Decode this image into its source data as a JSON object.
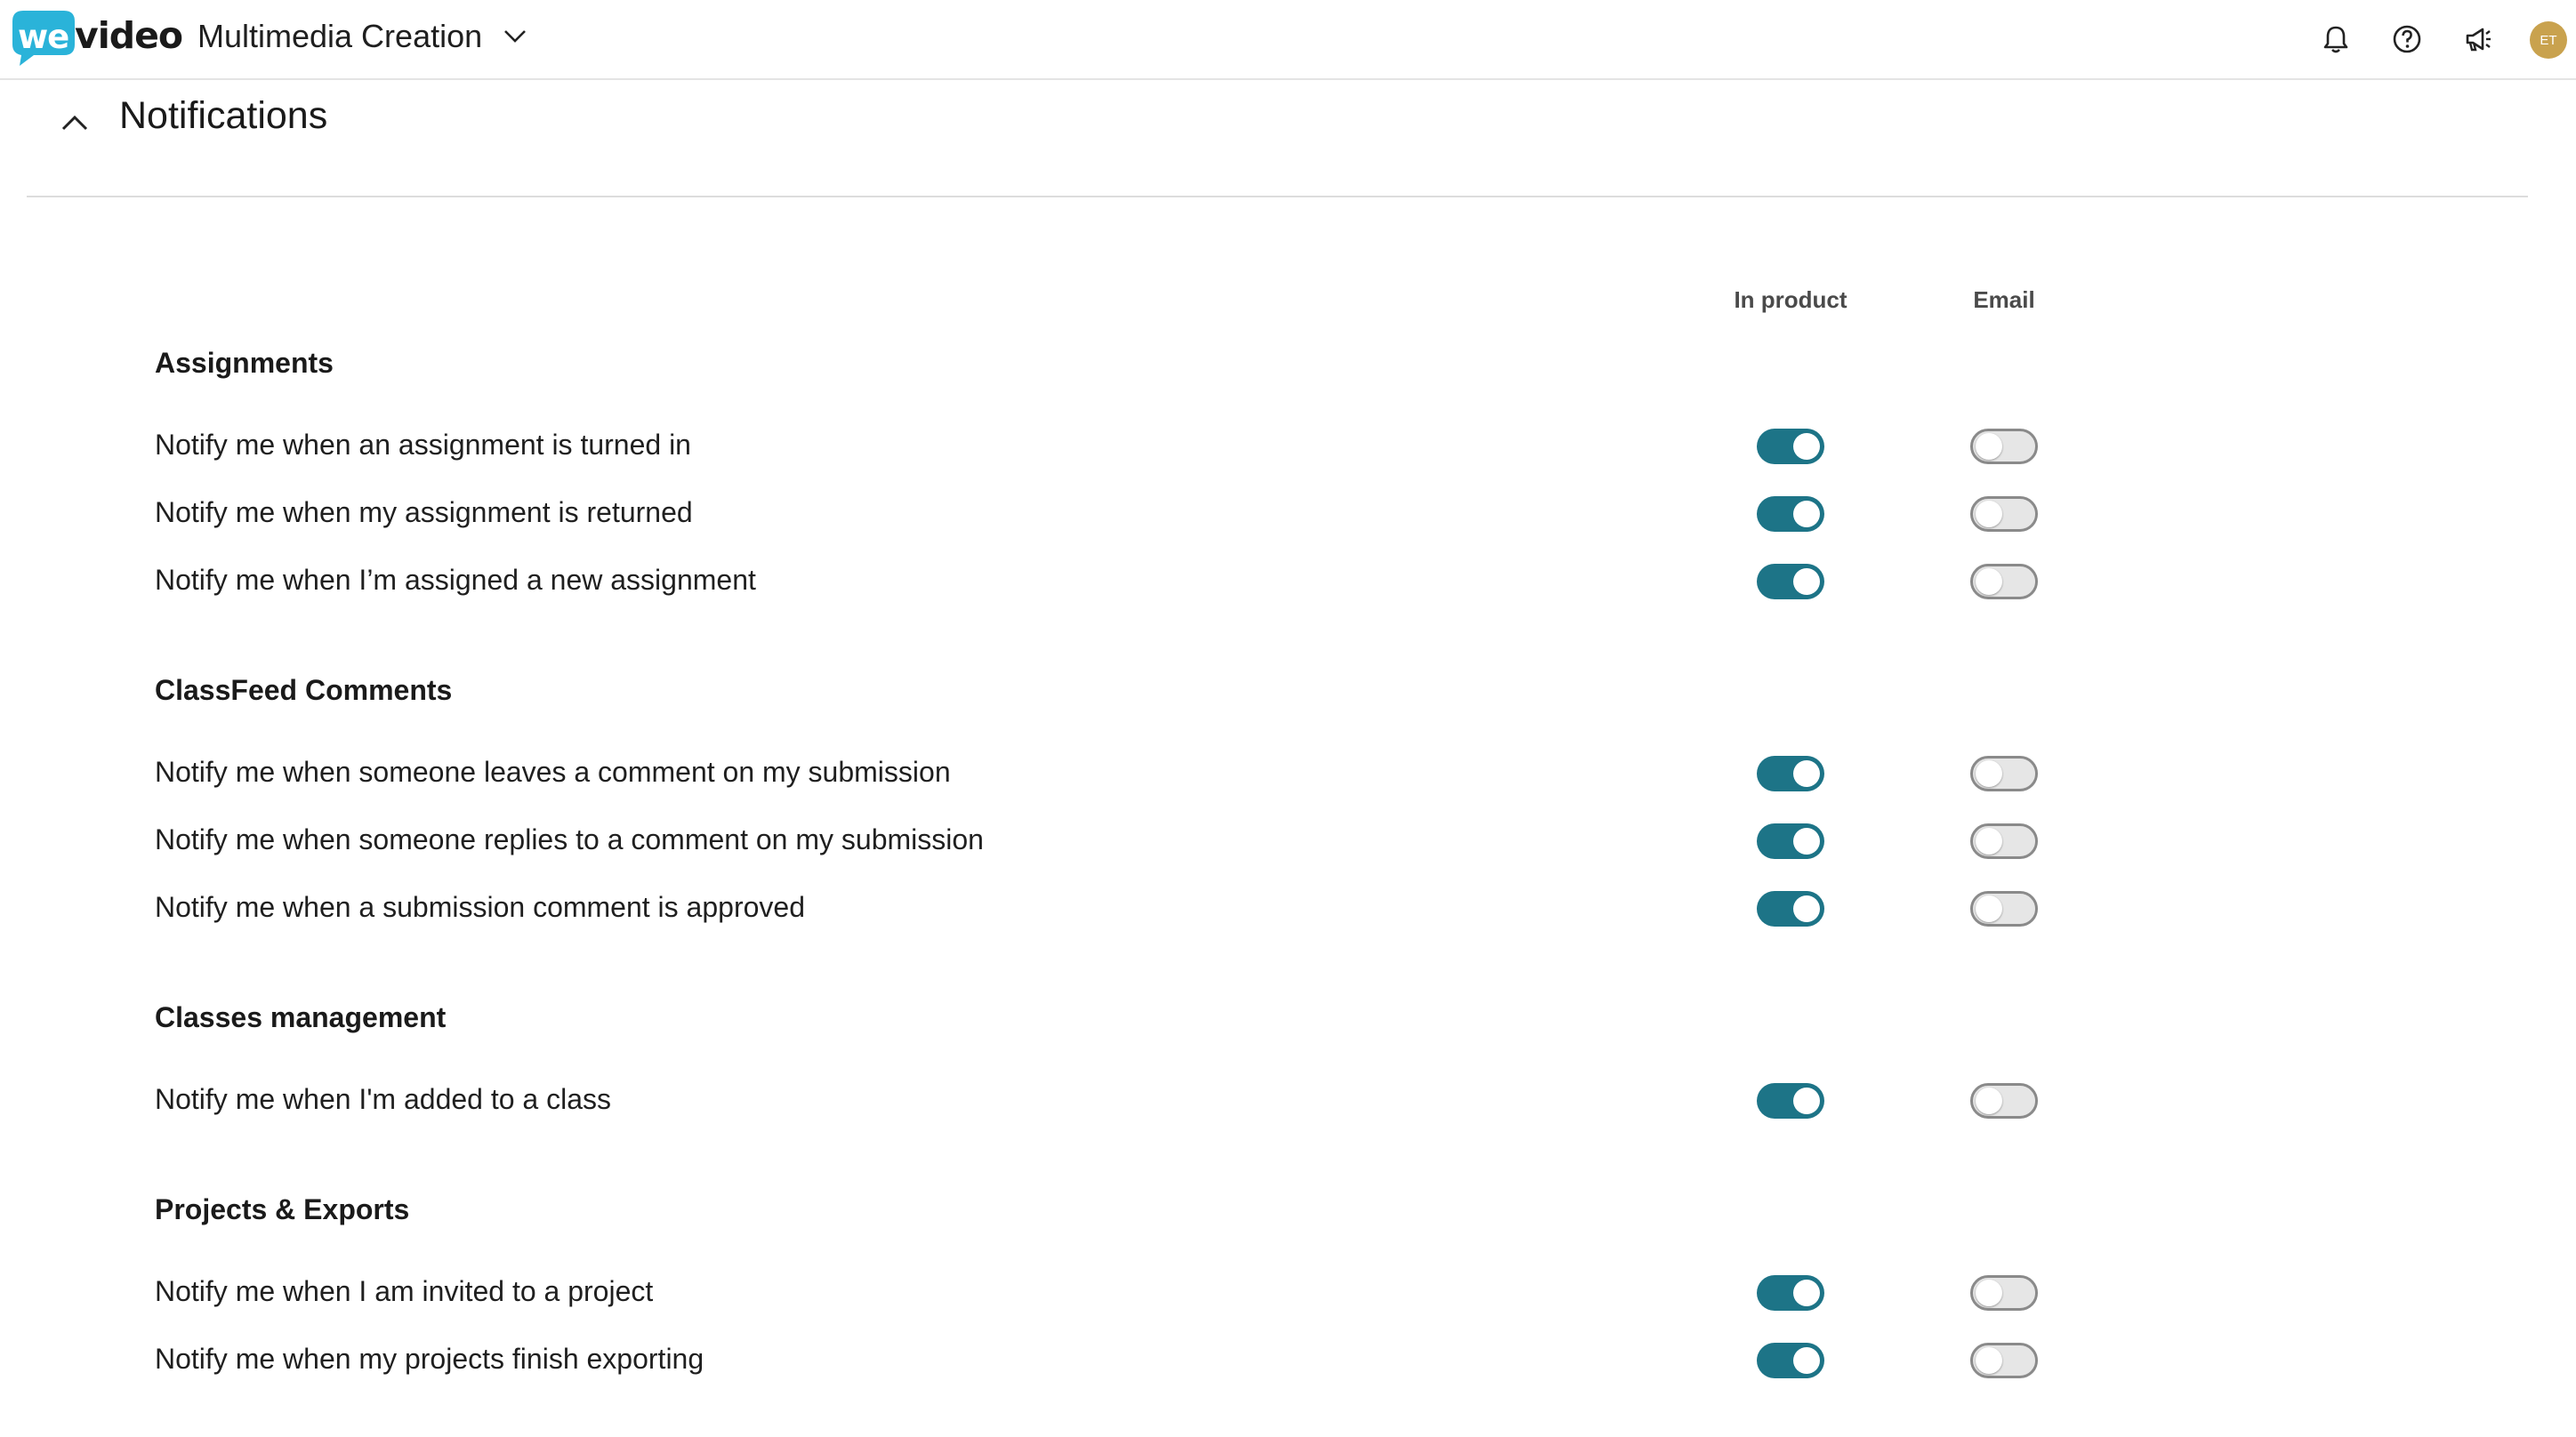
{
  "header": {
    "logo_we": "we",
    "logo_video": "video",
    "workspace_name": "Multimedia Creation",
    "avatar_initials": "ET"
  },
  "colors": {
    "toggle_on": "#1d7487",
    "logo_blue": "#2ab3d9",
    "avatar": "#c9a24e"
  },
  "section": {
    "title": "Notifications"
  },
  "columns": {
    "in_product": "In product",
    "email": "Email"
  },
  "groups": [
    {
      "title": "Assignments",
      "rows": [
        {
          "label": "Notify me when an assignment is turned in",
          "in_product": true,
          "email": false
        },
        {
          "label": "Notify me when my assignment is returned",
          "in_product": true,
          "email": false
        },
        {
          "label": "Notify me when I’m assigned a new assignment",
          "in_product": true,
          "email": false
        }
      ]
    },
    {
      "title": "ClassFeed Comments",
      "rows": [
        {
          "label": "Notify me when someone leaves a comment on my submission",
          "in_product": true,
          "email": false
        },
        {
          "label": "Notify me when someone replies to a comment on my submission",
          "in_product": true,
          "email": false
        },
        {
          "label": "Notify me when a submission comment is approved",
          "in_product": true,
          "email": false
        }
      ]
    },
    {
      "title": "Classes management",
      "rows": [
        {
          "label": "Notify me when I'm added to a class",
          "in_product": true,
          "email": false
        }
      ]
    },
    {
      "title": "Projects & Exports",
      "rows": [
        {
          "label": "Notify me when I am invited to a project",
          "in_product": true,
          "email": false
        },
        {
          "label": "Notify me when my projects finish exporting",
          "in_product": true,
          "email": false
        }
      ]
    }
  ]
}
